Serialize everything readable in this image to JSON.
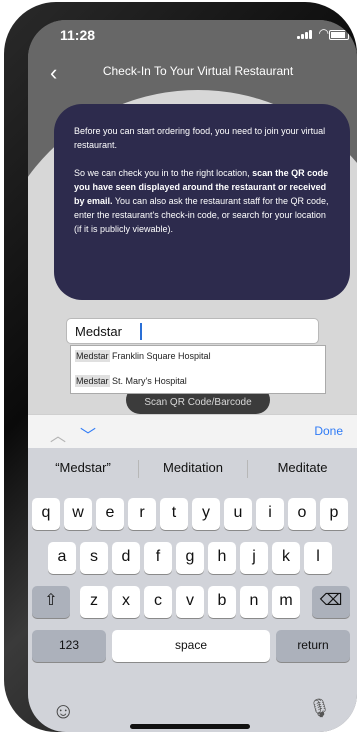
{
  "status_bar": {
    "time": "11:28"
  },
  "header": {
    "back_label": "‹",
    "title": "Check-In To Your Virtual Restaurant"
  },
  "card": {
    "para1": "Before you can start ordering food, you need to join your virtual restaurant.",
    "para2_prefix": "So we can check you in to the right location, ",
    "para2_bold": "scan the QR code you have seen displayed around the restaurant or received by email.",
    "para2_suffix": " You can also ask the restaurant staff for the QR code, enter the restaurant's check-in code, or search for your location (if it is publicly viewable)."
  },
  "search": {
    "value": "Medstar"
  },
  "suggestions_list": [
    {
      "highlight": "Medstar",
      "rest": " Franklin Square Hospital"
    },
    {
      "highlight": "Medstar",
      "rest": " St. Mary's Hospital"
    }
  ],
  "scan_button": {
    "label": "Scan QR Code/Barcode"
  },
  "accessory": {
    "done_label": "Done"
  },
  "keyboard": {
    "suggestions": [
      "“Medstar”",
      "Meditation",
      "Meditate"
    ],
    "row1": [
      "q",
      "w",
      "e",
      "r",
      "t",
      "y",
      "u",
      "i",
      "o",
      "p"
    ],
    "row2": [
      "a",
      "s",
      "d",
      "f",
      "g",
      "h",
      "j",
      "k",
      "l"
    ],
    "row3": [
      "z",
      "x",
      "c",
      "v",
      "b",
      "n",
      "m"
    ],
    "numbers_label": "123",
    "space_label": "space",
    "return_label": "return"
  },
  "icons": {
    "shift": "shift-icon",
    "backspace": "backspace-icon",
    "emoji": "emoji-icon",
    "mic": "microphone-icon"
  },
  "colors": {
    "card_bg": "#2d2b4d",
    "accent_blue": "#2f7bf6"
  }
}
